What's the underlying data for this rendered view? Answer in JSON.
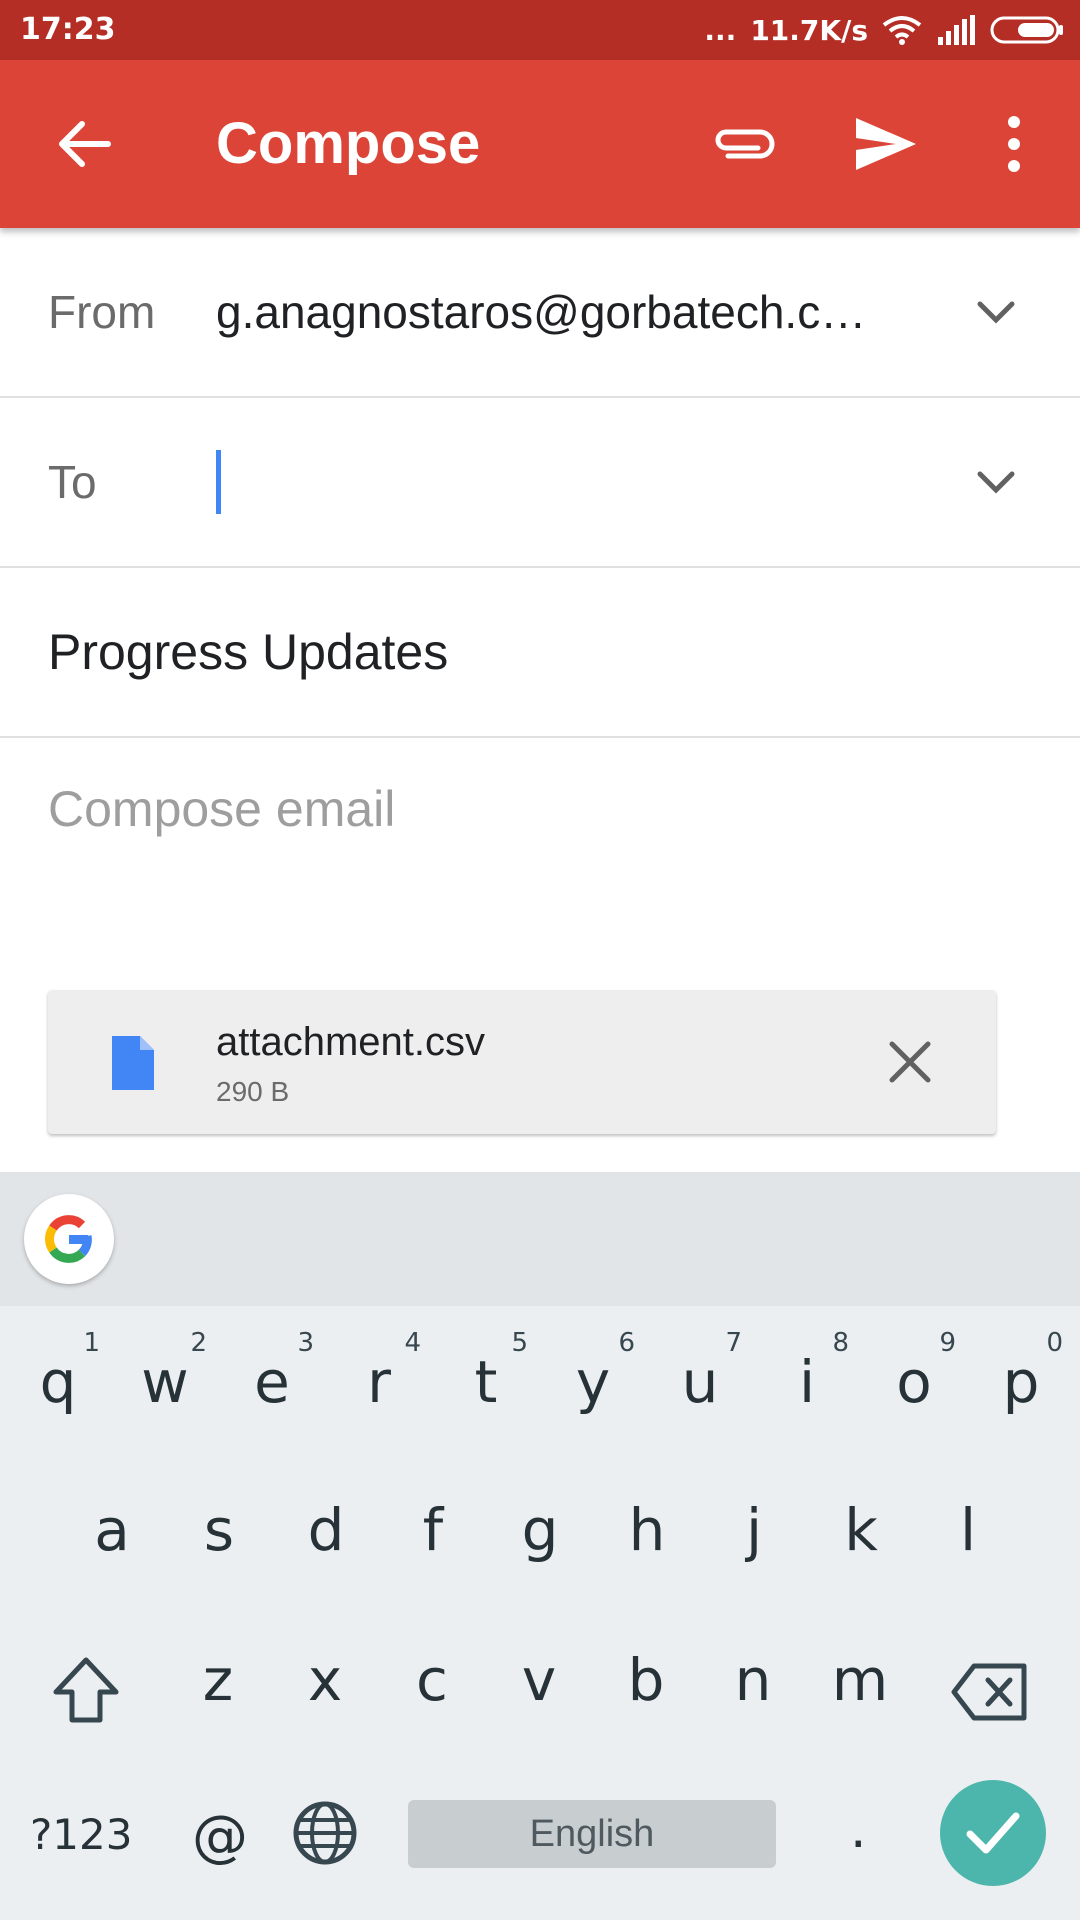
{
  "status_bar": {
    "time": "17:23",
    "dots": "...",
    "speed": "11.7K/s"
  },
  "app_bar": {
    "title": "Compose"
  },
  "from": {
    "label": "From",
    "value": "g.anagnostaros@gorbatech.c…"
  },
  "to": {
    "label": "To",
    "value": ""
  },
  "subject": {
    "value": "Progress Updates"
  },
  "body": {
    "placeholder": "Compose email"
  },
  "attachment": {
    "name": "attachment.csv",
    "size": "290 B"
  },
  "keyboard": {
    "row1": [
      {
        "k": "q",
        "h": "1"
      },
      {
        "k": "w",
        "h": "2"
      },
      {
        "k": "e",
        "h": "3"
      },
      {
        "k": "r",
        "h": "4"
      },
      {
        "k": "t",
        "h": "5"
      },
      {
        "k": "y",
        "h": "6"
      },
      {
        "k": "u",
        "h": "7"
      },
      {
        "k": "i",
        "h": "8"
      },
      {
        "k": "o",
        "h": "9"
      },
      {
        "k": "p",
        "h": "0"
      }
    ],
    "row2": [
      "a",
      "s",
      "d",
      "f",
      "g",
      "h",
      "j",
      "k",
      "l"
    ],
    "row3": [
      "z",
      "x",
      "c",
      "v",
      "b",
      "n",
      "m"
    ],
    "symbols": "?123",
    "at": "@",
    "space": "English",
    "period": "."
  },
  "colors": {
    "app_bar": "#db4437",
    "status_bar": "#b52e25",
    "accent": "#4285f4",
    "enter": "#4db6ac"
  }
}
